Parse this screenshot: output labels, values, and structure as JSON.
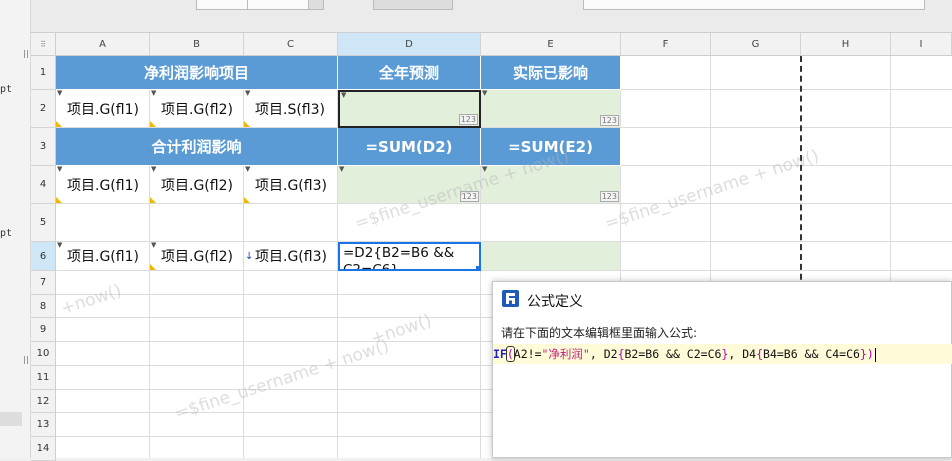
{
  "left_panel": {
    "labels": [
      "pt",
      "pt"
    ]
  },
  "columns": [
    "A",
    "B",
    "C",
    "D",
    "E",
    "F",
    "G",
    "H",
    "I"
  ],
  "rows": [
    "1",
    "2",
    "3",
    "4",
    "5",
    "6",
    "7",
    "8",
    "9",
    "10",
    "11",
    "12",
    "13",
    "14"
  ],
  "cells": {
    "r1_abc": "净利润影响项目",
    "r1_d": "全年预测",
    "r1_e": "实际已影响",
    "r2_a": "项目.G(fl1)",
    "r2_b": "项目.G(fl2)",
    "r2_c": "项目.S(fl3)",
    "r3_abc": "合计利润影响",
    "r3_d": "=SUM(D2)",
    "r3_e": "=SUM(E2)",
    "r4_a": "项目.G(fl1)",
    "r4_b": "项目.G(fl2)",
    "r4_c": "项目.G(fl3)",
    "r6_a": "项目.G(fl1)",
    "r6_b": "项目.G(fl2)",
    "r6_c": "项目.G(fl3)",
    "r6_d": "=D2{B2=B6 && C2=C6}",
    "badge": "123"
  },
  "watermark": {
    "text_a": "=$fine_username + now()",
    "text_b": "+now()"
  },
  "dialog": {
    "title": "公式定义",
    "prompt": "请在下面的文本编辑框里面输入公式:",
    "formula": {
      "t1": "IF",
      "t2": "(",
      "t3": "A2!=",
      "t4": "\"净利润\"",
      "t5": ", D2",
      "t6": "{",
      "t7": "B2=B6 && C2=C6",
      "t8": "}",
      "t9": ", D4",
      "t10": "{",
      "t11": "B4=B6 && C4=C6",
      "t12": "}",
      "t13": ")"
    }
  },
  "colors": {
    "header_blue": "#5b9bd5",
    "formula_green": "#e2efda",
    "selection": "#cfe6f7"
  }
}
